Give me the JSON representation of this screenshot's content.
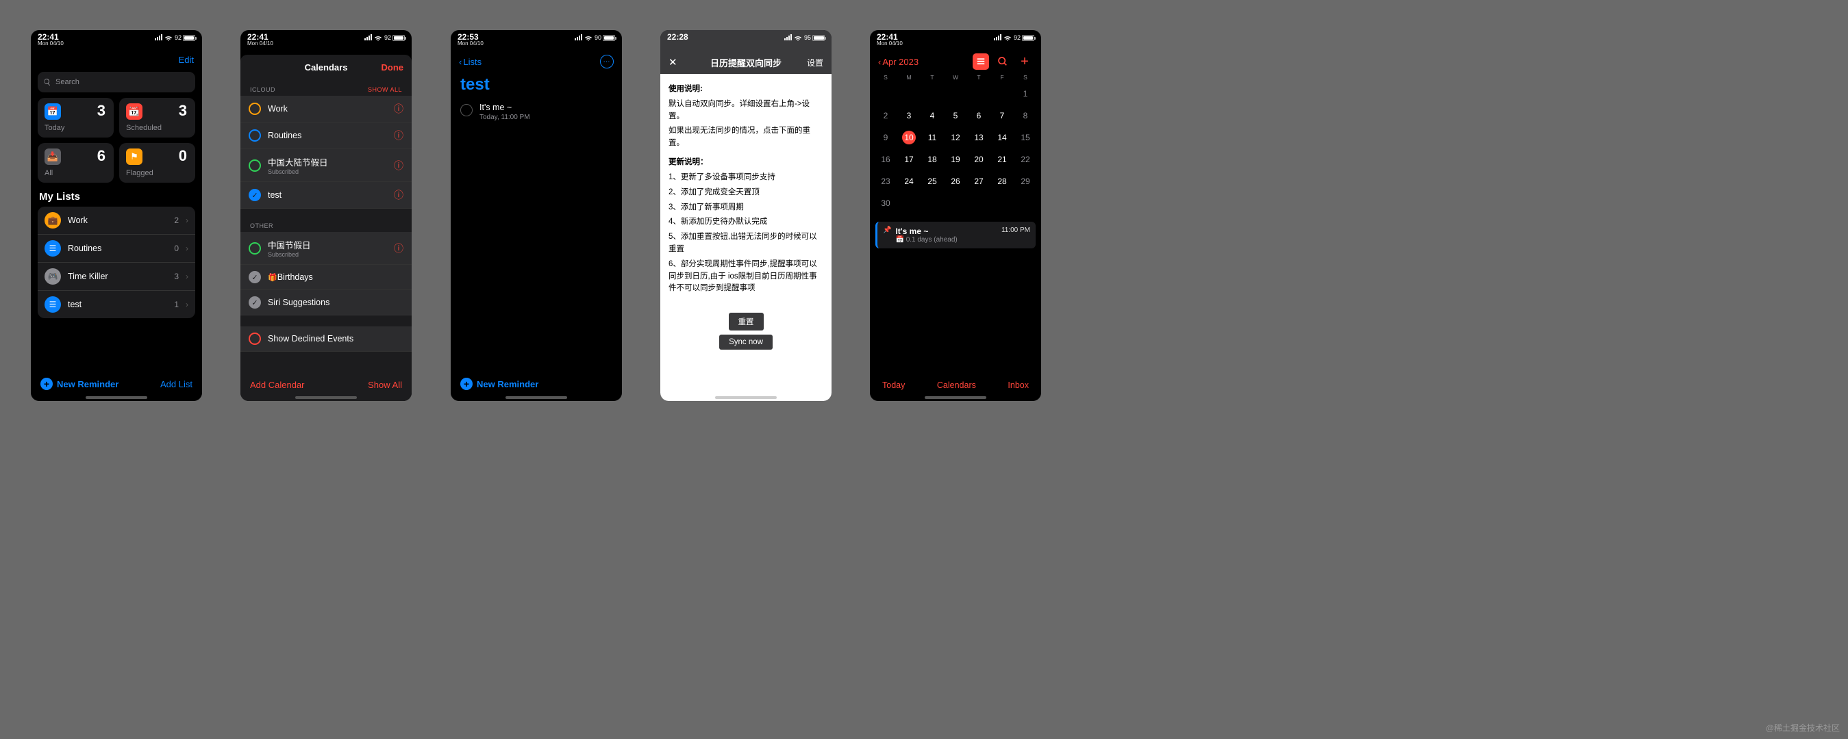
{
  "watermark": "@稀土掘金技术社区",
  "status": {
    "time_2241": "22:41",
    "time_2253": "22:53",
    "time_2228": "22:28",
    "date": "Mon 04/10",
    "battery_92": "92",
    "battery_90": "90",
    "battery_95": "95"
  },
  "p1": {
    "edit": "Edit",
    "search_placeholder": "Search",
    "cards": {
      "today": {
        "label": "Today",
        "count": "3"
      },
      "scheduled": {
        "label": "Scheduled",
        "count": "3"
      },
      "all": {
        "label": "All",
        "count": "6"
      },
      "flagged": {
        "label": "Flagged",
        "count": "0"
      }
    },
    "my_lists": "My Lists",
    "lists": [
      {
        "name": "Work",
        "count": "2",
        "color": "#ff9f0a",
        "icon": "briefcase"
      },
      {
        "name": "Routines",
        "count": "0",
        "color": "#0a84ff",
        "icon": "list"
      },
      {
        "name": "Time Killer",
        "count": "3",
        "color": "#8e8e93",
        "icon": "gamepad"
      },
      {
        "name": "test",
        "count": "1",
        "color": "#0a84ff",
        "icon": "list"
      }
    ],
    "new_reminder": "New Reminder",
    "add_list": "Add List"
  },
  "p2": {
    "title": "Calendars",
    "done": "Done",
    "sections": {
      "icloud": {
        "header": "ICLOUD",
        "action": "SHOW ALL"
      },
      "other": {
        "header": "OTHER"
      }
    },
    "icloud_cals": [
      {
        "name": "Work",
        "color": "#ff9f0a",
        "checked": false,
        "info": true
      },
      {
        "name": "Routines",
        "color": "#0a84ff",
        "checked": false,
        "info": true
      },
      {
        "name": "中国大陆节假日",
        "sub": "Subscribed",
        "color": "#30d158",
        "checked": false,
        "info": true
      },
      {
        "name": "test",
        "color": "#0a84ff",
        "checked": true,
        "info": true
      }
    ],
    "other_cals": [
      {
        "name": "中国节假日",
        "sub": "Subscribed",
        "color": "#30d158",
        "checked": false,
        "info": true
      },
      {
        "name": "Birthdays",
        "gift": true,
        "color": "#8e8e93",
        "checked": true
      },
      {
        "name": "Siri Suggestions",
        "color": "#8e8e93",
        "checked": true
      }
    ],
    "declined": "Show Declined Events",
    "add_calendar": "Add Calendar",
    "show_all": "Show All"
  },
  "p3": {
    "back": "Lists",
    "title": "test",
    "item": {
      "title": "It's me ~",
      "sub": "Today, 11:00 PM"
    },
    "new_reminder": "New Reminder"
  },
  "p4": {
    "title": "日历提醒双向同步",
    "settings": "设置",
    "h1": "使用说明:",
    "p1a": "默认自动双向同步。详细设置右上角->设置。",
    "p1b": "如果出现无法同步的情况，点击下面的重置。",
    "h2": "更新说明：",
    "l1": "1、更新了多设备事项同步支持",
    "l2": "2、添加了完成变全天置顶",
    "l3": "3、添加了新事项周期",
    "l4": "4、新添加历史待办默认完成",
    "l5": "5、添加重置按钮,出错无法同步的时候可以重置",
    "l6": "6、部分实现周期性事件同步,提醒事项可以同步到日历,由于 ios限制目前日历周期性事件不可以同步到提醒事项",
    "reset": "重置",
    "sync": "Sync now"
  },
  "p5": {
    "month": "Apr 2023",
    "dow": [
      "S",
      "M",
      "T",
      "W",
      "T",
      "F",
      "S"
    ],
    "days": [
      [
        "",
        "",
        "",
        "",
        "",
        "",
        "1"
      ],
      [
        "2",
        "3",
        "4",
        "5",
        "6",
        "7",
        "8"
      ],
      [
        "9",
        "10",
        "11",
        "12",
        "13",
        "14",
        "15"
      ],
      [
        "16",
        "17",
        "18",
        "19",
        "20",
        "21",
        "22"
      ],
      [
        "23",
        "24",
        "25",
        "26",
        "27",
        "28",
        "29"
      ],
      [
        "30",
        "",
        "",
        "",
        "",
        "",
        ""
      ]
    ],
    "selected": "10",
    "event": {
      "title": "It's me ~",
      "sub": "0.1 days (ahead)",
      "time": "11:00 PM"
    },
    "today": "Today",
    "calendars": "Calendars",
    "inbox": "Inbox"
  }
}
